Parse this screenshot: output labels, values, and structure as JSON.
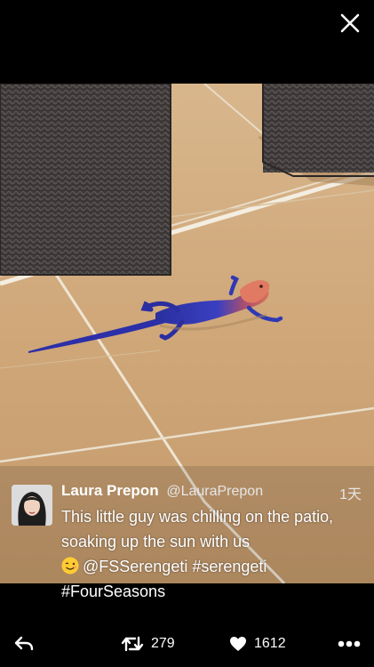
{
  "tweet": {
    "author_name": "Laura Prepon",
    "author_handle": "@LauraPrepon",
    "timestamp": "1天",
    "text_line1": "This little guy was chilling on the patio, soaking up the sun with us",
    "text_mentions": "@FSSerengeti #serengeti",
    "text_hashtag": "#FourSeasons",
    "emoji": "smiling-face-emoji"
  },
  "actions": {
    "retweet_count": "279",
    "like_count": "1612"
  },
  "icons": {
    "close": "close-icon",
    "reply": "reply-icon",
    "retweet": "retweet-icon",
    "like": "heart-icon",
    "more": "more-dots-icon"
  },
  "colors": {
    "background": "#000000",
    "text": "#ffffff"
  }
}
